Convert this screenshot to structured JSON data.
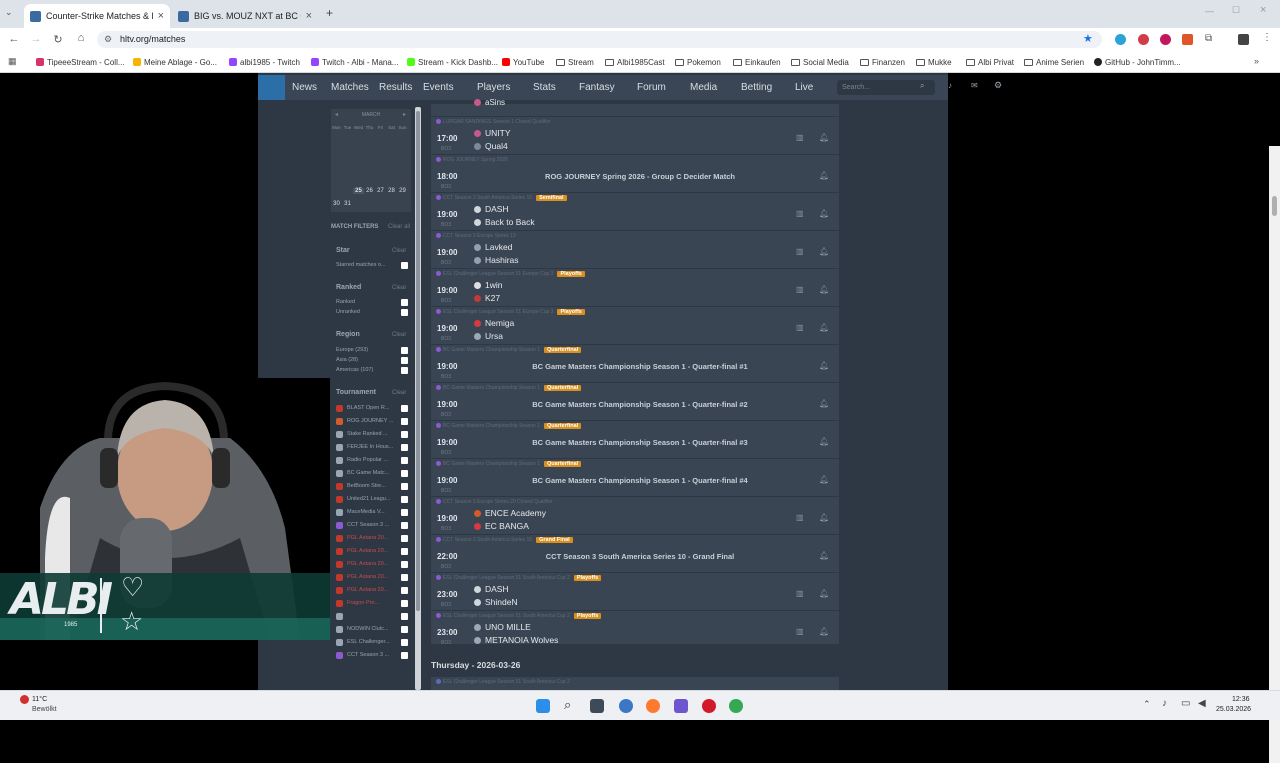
{
  "browser": {
    "tabs": [
      {
        "title": "Counter-Strike Matches & lives",
        "active": true
      },
      {
        "title": "BIG vs. MOUZ NXT at BC Game",
        "active": false
      }
    ],
    "url": "hltv.org/matches",
    "bookmarks": [
      "TipeeeStream - Coll...",
      "Meine Ablage - Go...",
      "albi1985 - Twitch",
      "Twitch - Albi - Mana...",
      "Stream - Kick Dashb...",
      "YouTube",
      "Stream",
      "Albi1985Cast",
      "Pokemon",
      "Einkaufen",
      "Social Media",
      "Finanzen",
      "Mukke",
      "Albi Privat",
      "Anime Serien",
      "GitHub - JohnTimm..."
    ]
  },
  "nav": {
    "items": [
      "News",
      "Matches",
      "Results",
      "Events",
      "Players",
      "Stats",
      "Fantasy",
      "Forum",
      "Media",
      "Betting",
      "Live"
    ],
    "search_placeholder": "Search..."
  },
  "calendar": {
    "month": "MARCH",
    "days_header": [
      "Mon",
      "Tue",
      "Wed",
      "Thu",
      "Fri",
      "Sat",
      "Sun"
    ],
    "visible_days": [
      "25",
      "26",
      "27",
      "28",
      "29",
      "30",
      "31"
    ]
  },
  "filters": {
    "title": "MATCH FILTERS",
    "clear_all": "Clear all",
    "clear": "Clear",
    "star": {
      "label": "Star",
      "items": [
        "Starred matches o..."
      ]
    },
    "ranked": {
      "label": "Ranked",
      "items": [
        "Ranked",
        "Unranked"
      ]
    },
    "region": {
      "label": "Region",
      "items": [
        "Europe (293)",
        "Asia (28)",
        "Americas (107)"
      ]
    },
    "tournament": {
      "label": "Tournament",
      "items": [
        "BLAST Open R...",
        "ROG JOURNEY ...",
        "Stake Ranked ...",
        "FERJEE In Hous...",
        "Radio Popular ...",
        "BC Game Matc...",
        "BetBoom Stre...",
        "United21 Leagu...",
        "MaceMedia V...",
        "CCT Season 3 ...",
        "PGL Astana 20...",
        "PGL Astana 20...",
        "PGL Astana 20...",
        "PGL Astana 20...",
        "PGL Astana 20...",
        "Fragon Pro...",
        "",
        "NODWIN Clutc...",
        "ESL Challenger...",
        "CCT Season 3 ..."
      ]
    }
  },
  "matches": [
    {
      "event": "LURGAR SANDINGS Season 1 Closed Qualifier",
      "badge": "",
      "time": "17:00",
      "format": "BO3",
      "team1": "UNITY",
      "team2": "Qual4",
      "c1": "#c65a8a",
      "c2": "#7a8a9a"
    },
    {
      "event": "ROG JOURNEY Spring 2026",
      "badge": "",
      "time": "18:00",
      "format": "BO3",
      "wide": "ROG JOURNEY Spring 2026 - Group C Decider Match"
    },
    {
      "event": "CCT Season 3 South America Series 10",
      "badge": "Semifinal",
      "time": "19:00",
      "format": "BO3",
      "team1": "DASH",
      "team2": "Back to Back",
      "c1": "#cfd6dd",
      "c2": "#cfd6dd"
    },
    {
      "event": "CCT Season 3 Europe Series 19",
      "badge": "",
      "time": "19:00",
      "format": "BO3",
      "team1": "Lavked",
      "team2": "Hashiras",
      "c1": "#8fa0b2",
      "c2": "#8fa0b2"
    },
    {
      "event": "ESL Challenger League Season 51 Europe Cup 3",
      "badge": "Playoffs",
      "time": "19:00",
      "format": "BO3",
      "team1": "1win",
      "team2": "K27",
      "c1": "#e0e0e0",
      "c2": "#c23a3a"
    },
    {
      "event": "ESL Challenger League Season 51 Europe Cup 3",
      "badge": "Playoffs",
      "time": "19:00",
      "format": "BO3",
      "team1": "Nemiga",
      "team2": "Ursa",
      "c1": "#d8383f",
      "c2": "#9aa8b8"
    },
    {
      "event": "BC Game Masters Championship Season 1",
      "badge": "Quarterfinal",
      "time": "19:00",
      "format": "BO3",
      "wide": "BC Game Masters Championship Season 1 - Quarter-final #1"
    },
    {
      "event": "BC Game Masters Championship Season 1",
      "badge": "Quarterfinal",
      "time": "19:00",
      "format": "BO3",
      "wide": "BC Game Masters Championship Season 1 - Quarter-final #2"
    },
    {
      "event": "BC Game Masters Championship Season 1",
      "badge": "Quarterfinal",
      "time": "19:00",
      "format": "BO3",
      "wide": "BC Game Masters Championship Season 1 - Quarter-final #3"
    },
    {
      "event": "BC Game Masters Championship Season 1",
      "badge": "Quarterfinal",
      "time": "19:00",
      "format": "BO3",
      "wide": "BC Game Masters Championship Season 1 - Quarter-final #4"
    },
    {
      "event": "CCT Season 3 Europe Series 20 Closed Qualifier",
      "badge": "",
      "time": "19:00",
      "format": "BO3",
      "team1": "ENCE Academy",
      "team2": "EC BANGA",
      "c1": "#d35a2a",
      "c2": "#d8383f"
    },
    {
      "event": "CCT Season 3 South America Series 10",
      "badge": "Grand Final",
      "time": "22:00",
      "format": "BO3",
      "wide": "CCT Season 3 South America Series 10 - Grand Final"
    },
    {
      "event": "ESL Challenger League Season 51 South America Cup 2",
      "badge": "Playoffs",
      "time": "23:00",
      "format": "BO3",
      "team1": "DASH",
      "team2": "ShindeN",
      "c1": "#cfd6dd",
      "c2": "#cfd6dd"
    },
    {
      "event": "ESL Challenger League Season 51 South America Cup 2",
      "badge": "Playoffs",
      "time": "23:00",
      "format": "BO3",
      "team1": "UNO MILLE",
      "team2": "METANOIA Wolves",
      "c1": "#9aa8b8",
      "c2": "#9aa8b8"
    }
  ],
  "top_partial_team": "aSins",
  "day_heading": "Thursday - 2026-03-26",
  "next_event": "ESL Challenger League Season 51 South America Cup 2",
  "taskbar": {
    "temperature": "11°C",
    "weather": "Bewölkt",
    "time": "12:36",
    "date": "25.03.2026"
  },
  "overlay": {
    "brand": "ALBI",
    "year": "1985"
  }
}
